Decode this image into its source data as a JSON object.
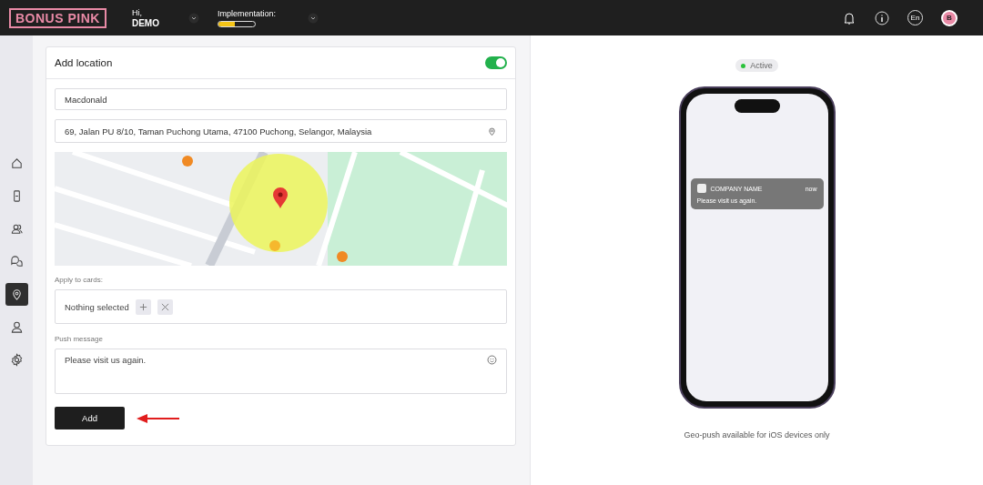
{
  "header": {
    "logo": "BONUS PINK",
    "greeting": "Hi,",
    "user": "DEMO",
    "implementation_label": "Implementation:",
    "implementation": {
      "level": 0.45
    },
    "language": "En",
    "avatar": "B"
  },
  "sidebar": {
    "items": [
      {
        "kind": "home",
        "selected": false
      },
      {
        "kind": "device",
        "selected": false
      },
      {
        "kind": "users",
        "selected": false
      },
      {
        "kind": "chat",
        "selected": false
      },
      {
        "kind": "location",
        "selected": true
      },
      {
        "kind": "user",
        "selected": false
      },
      {
        "kind": "settings",
        "selected": false
      }
    ]
  },
  "form": {
    "title": "Add location",
    "enabled": true,
    "name_value": "Macdonald",
    "address_value": "69, Jalan PU 8/10, Taman Puchong Utama, 47100 Puchong, Selangor, Malaysia",
    "cards_label": "Apply to cards:",
    "cards_value": "Nothing selected",
    "message_label": "Push message",
    "message_value": "Please visit us again.",
    "submit": "Add"
  },
  "preview": {
    "status": "Active",
    "active": true,
    "notification": {
      "company": "COMPANY NAME",
      "time": "now",
      "message": "Please visit us again."
    },
    "footnote": "Geo-push available for iOS devices only"
  }
}
